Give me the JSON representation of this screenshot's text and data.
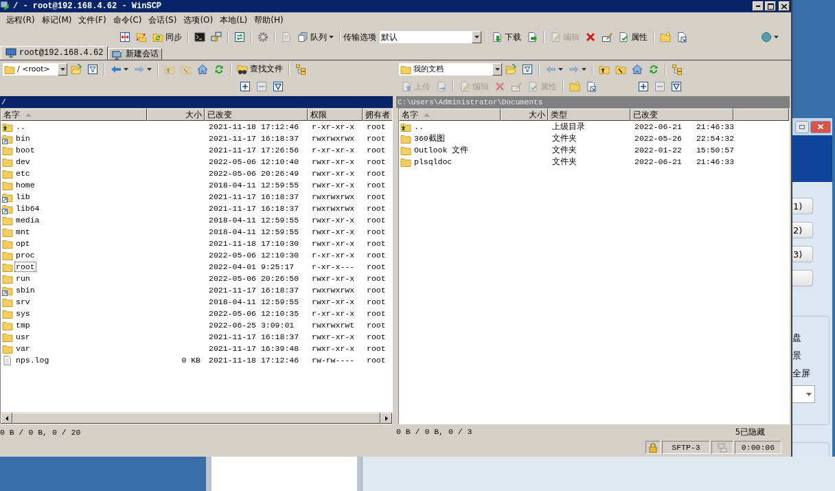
{
  "window": {
    "title": "/ - root@192.168.4.62 - WinSCP"
  },
  "menu": [
    "远程(R)",
    "标记(M)",
    "文件(F)",
    "命令(C)",
    "会话(S)",
    "选项(O)",
    "本地(L)",
    "帮助(H)"
  ],
  "main_toolbar": [
    {
      "kind": "compare",
      "disabled": false
    },
    {
      "kind": "sync-folders",
      "disabled": false
    },
    {
      "kind": "synchronize",
      "label": "同步",
      "disabled": false
    },
    {
      "kind": "separator"
    },
    {
      "kind": "terminal",
      "disabled": false
    },
    {
      "kind": "putty",
      "disabled": false
    },
    {
      "kind": "separator"
    },
    {
      "kind": "navigate",
      "disabled": false
    },
    {
      "kind": "separator"
    },
    {
      "kind": "preferences",
      "disabled": false
    },
    {
      "kind": "separator"
    },
    {
      "kind": "queue-doc",
      "disabled": true
    },
    {
      "kind": "queue",
      "label": "队列",
      "disabled": false
    },
    {
      "kind": "separator"
    },
    {
      "kind": "label",
      "text": "传输选项"
    },
    {
      "kind": "preset",
      "value": "默认"
    },
    {
      "kind": "separator"
    },
    {
      "kind": "download",
      "label": "下载",
      "disabled": false
    },
    {
      "kind": "download-alt",
      "disabled": false
    },
    {
      "kind": "separator"
    },
    {
      "kind": "edit",
      "label": "编辑",
      "disabled": true
    },
    {
      "kind": "delete",
      "disabled": false
    },
    {
      "kind": "rename",
      "disabled": false
    },
    {
      "kind": "properties",
      "label": "属性",
      "disabled": false
    },
    {
      "kind": "separator"
    },
    {
      "kind": "new-folder",
      "disabled": false
    },
    {
      "kind": "shortcut",
      "disabled": false
    },
    {
      "kind": "network",
      "disabled": false
    }
  ],
  "tabs": [
    {
      "label": "root@192.168.4.62",
      "selected": true
    },
    {
      "label": "新建会话",
      "selected": false
    }
  ],
  "panels": [
    {
      "active": true,
      "toolbar": [
        {
          "kind": "path",
          "value": "/ <root>"
        },
        {
          "kind": "open-dir",
          "disabled": false
        },
        {
          "kind": "filter",
          "disabled": false
        },
        {
          "kind": "separator"
        },
        {
          "kind": "back",
          "disabled": false
        },
        {
          "kind": "forward",
          "disabled": true
        },
        {
          "kind": "separator"
        },
        {
          "kind": "parent-dir",
          "disabled": true
        },
        {
          "kind": "root-dir",
          "disabled": true
        },
        {
          "kind": "home",
          "disabled": false
        },
        {
          "kind": "refresh",
          "disabled": false
        },
        {
          "kind": "separator"
        },
        {
          "kind": "find",
          "label": "查找文件",
          "disabled": false
        },
        {
          "kind": "separator"
        },
        {
          "kind": "tree",
          "disabled": false
        }
      ],
      "toolbar_2": [
        {
          "kind": "select-all",
          "disabled": false
        },
        {
          "kind": "unselect",
          "disabled": true
        },
        {
          "kind": "filter-select",
          "disabled": false
        }
      ],
      "path": "/",
      "columns": [
        {
          "label": "名字",
          "sorted": true
        },
        {
          "label": "大小",
          "sorted": false
        },
        {
          "label": "已改变",
          "sorted": false
        },
        {
          "label": "权限",
          "sorted": false
        },
        {
          "label": "拥有者",
          "sorted": false
        }
      ],
      "rows": [
        {
          "kind": "parent",
          "name": "..",
          "changed": "2021-11-18 17:12:46",
          "rights": "r-xr-xr-x",
          "owner": "root",
          "focused": false
        },
        {
          "kind": "link",
          "name": "bin",
          "changed": "2021-11-17 16:18:37",
          "rights": "rwxrwxrwx",
          "owner": "root",
          "focused": false
        },
        {
          "kind": "folder",
          "name": "boot",
          "changed": "2021-11-17 17:26:56",
          "rights": "r-xr-xr-x",
          "owner": "root",
          "focused": false
        },
        {
          "kind": "folder",
          "name": "dev",
          "changed": "2022-05-06 12:10:40",
          "rights": "rwxr-xr-x",
          "owner": "root",
          "focused": false
        },
        {
          "kind": "folder",
          "name": "etc",
          "changed": "2022-05-06 20:26:49",
          "rights": "rwxr-xr-x",
          "owner": "root",
          "focused": false
        },
        {
          "kind": "folder",
          "name": "home",
          "changed": "2018-04-11 12:59:55",
          "rights": "rwxr-xr-x",
          "owner": "root",
          "focused": false
        },
        {
          "kind": "link",
          "name": "lib",
          "changed": "2021-11-17 16:18:37",
          "rights": "rwxrwxrwx",
          "owner": "root",
          "focused": false
        },
        {
          "kind": "link",
          "name": "lib64",
          "changed": "2021-11-17 16:18:37",
          "rights": "rwxrwxrwx",
          "owner": "root",
          "focused": false
        },
        {
          "kind": "folder",
          "name": "media",
          "changed": "2018-04-11 12:59:55",
          "rights": "rwxr-xr-x",
          "owner": "root",
          "focused": false
        },
        {
          "kind": "folder",
          "name": "mnt",
          "changed": "2018-04-11 12:59:55",
          "rights": "rwxr-xr-x",
          "owner": "root",
          "focused": false
        },
        {
          "kind": "folder",
          "name": "opt",
          "changed": "2021-11-18 17:10:30",
          "rights": "rwxr-xr-x",
          "owner": "root",
          "focused": false
        },
        {
          "kind": "folder",
          "name": "proc",
          "changed": "2022-05-06 12:10:30",
          "rights": "r-xr-xr-x",
          "owner": "root",
          "focused": false
        },
        {
          "kind": "folder",
          "name": "root",
          "changed": "2022-04-01 9:25:17",
          "rights": "r-xr-x---",
          "owner": "root",
          "focused": true
        },
        {
          "kind": "folder",
          "name": "run",
          "changed": "2022-05-06 20:26:50",
          "rights": "rwxr-xr-x",
          "owner": "root",
          "focused": false
        },
        {
          "kind": "link",
          "name": "sbin",
          "changed": "2021-11-17 16:18:37",
          "rights": "rwxrwxrwx",
          "owner": "root",
          "focused": false
        },
        {
          "kind": "folder",
          "name": "srv",
          "changed": "2018-04-11 12:59:55",
          "rights": "rwxr-xr-x",
          "owner": "root",
          "focused": false
        },
        {
          "kind": "folder",
          "name": "sys",
          "changed": "2022-05-06 12:10:35",
          "rights": "r-xr-xr-x",
          "owner": "root",
          "focused": false
        },
        {
          "kind": "folder",
          "name": "tmp",
          "changed": "2022-06-25 3:09:01",
          "rights": "rwxrwxrwt",
          "owner": "root",
          "focused": false
        },
        {
          "kind": "folder",
          "name": "usr",
          "changed": "2021-11-17 16:18:37",
          "rights": "rwxr-xr-x",
          "owner": "root",
          "focused": false
        },
        {
          "kind": "folder",
          "name": "var",
          "changed": "2021-11-17 16:39:48",
          "rights": "rwxr-xr-x",
          "owner": "root",
          "focused": false
        },
        {
          "kind": "file",
          "name": "nps.log",
          "size": "0 KB",
          "changed": "2021-11-18 17:12:46",
          "rights": "rw-rw----",
          "owner": "root",
          "focused": false
        }
      ],
      "summary": "0 B / 0 B, 0 / 20"
    },
    {
      "active": false,
      "toolbar": [
        {
          "kind": "path",
          "value": "我的文档"
        },
        {
          "kind": "open-dir",
          "disabled": false
        },
        {
          "kind": "filter",
          "disabled": false
        },
        {
          "kind": "separator"
        },
        {
          "kind": "back",
          "disabled": true
        },
        {
          "kind": "forward",
          "disabled": true
        },
        {
          "kind": "separator"
        },
        {
          "kind": "parent-dir",
          "disabled": false
        },
        {
          "kind": "root-dir",
          "disabled": false
        },
        {
          "kind": "home",
          "disabled": false
        },
        {
          "kind": "refresh",
          "disabled": false
        },
        {
          "kind": "separator"
        },
        {
          "kind": "tree",
          "disabled": false
        }
      ],
      "toolbar_2": [
        {
          "kind": "upload",
          "label": "上传",
          "disabled": true
        },
        {
          "kind": "upload-alt",
          "disabled": true
        },
        {
          "kind": "separator"
        },
        {
          "kind": "edit",
          "label": "编辑",
          "disabled": true
        },
        {
          "kind": "delete",
          "disabled": true
        },
        {
          "kind": "rename",
          "disabled": true
        },
        {
          "kind": "properties",
          "label": "属性",
          "disabled": true
        },
        {
          "kind": "separator"
        },
        {
          "kind": "new-folder",
          "disabled": false
        },
        {
          "kind": "shortcut",
          "disabled": false
        },
        {
          "kind": "select-all",
          "disabled": false
        },
        {
          "kind": "unselect",
          "disabled": true
        },
        {
          "kind": "filter-select",
          "disabled": false
        }
      ],
      "path": "C:\\Users\\Administrator\\Documents",
      "columns": [
        {
          "label": "名字",
          "sorted": true
        },
        {
          "label": "大小",
          "sorted": false
        },
        {
          "label": "类型",
          "sorted": false
        },
        {
          "label": "已改变",
          "sorted": false
        }
      ],
      "rows": [
        {
          "kind": "parent",
          "name": "..",
          "type": "上级目录",
          "changed": "2022-06-21 21:46:33"
        },
        {
          "kind": "folder",
          "name": "360截图",
          "type": "文件夹",
          "changed": "2022-05-26 22:54:32"
        },
        {
          "kind": "folder",
          "name": "Outlook 文件",
          "type": "文件夹",
          "changed": "2022-01-22 15:50:57"
        },
        {
          "kind": "folder",
          "name": "plsqldoc",
          "type": "文件夹",
          "changed": "2022-06-21 21:46:33"
        }
      ],
      "summary": "0 B / 0 B, 0 / 3",
      "hidden_count": "5已隐藏"
    }
  ],
  "status_bar": {
    "protocol": "SFTP-3",
    "elapsed": "0:00:06"
  },
  "background_dialog": {
    "buttons": [
      "1)",
      "2)",
      "3)"
    ],
    "options": [
      "盘",
      "景",
      "全屏"
    ]
  }
}
